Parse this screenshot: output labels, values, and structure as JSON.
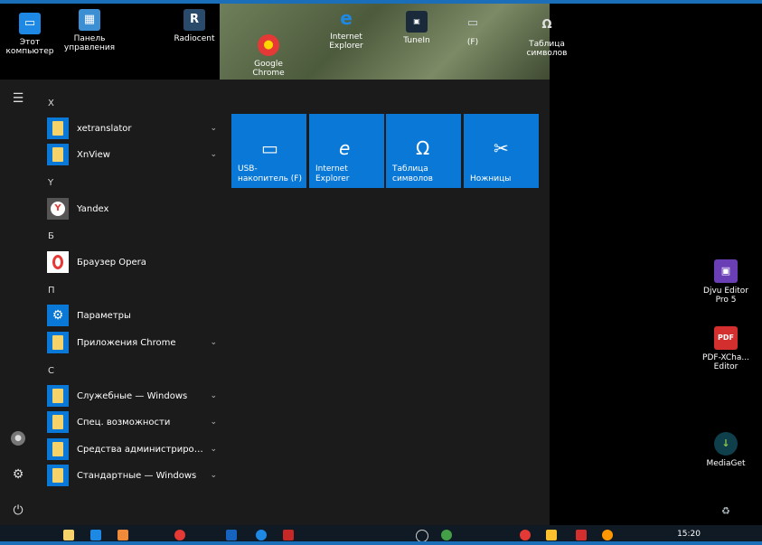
{
  "desktop_top": {
    "this_pc": "Этот компьютер",
    "control_panel": "Панель управления",
    "radiocent": "Radiocent",
    "chrome": "Google Chrome",
    "ie": "Internet Explorer",
    "tunein": "TuneIn",
    "f_drive": "(F)",
    "charmap": "Таблица символов"
  },
  "start": {
    "letters": [
      "X",
      "Y",
      "Б",
      "П",
      "С"
    ],
    "apps": {
      "xetranslator": "xetranslator",
      "xnview": "XnView",
      "yandex": "Yandex",
      "opera": "Браузер Opera",
      "params": "Параметры",
      "chrome_apps": "Приложения Chrome",
      "sys_tools": "Служебные — Windows",
      "access": "Спец. возможности",
      "admin": "Средства администрировани...",
      "standard": "Стандартные — Windows"
    },
    "chevron": "⌄"
  },
  "tiles": {
    "usb": "USB-накопитель (F)",
    "ie": "Internet Explorer",
    "charmap": "Таблица символов",
    "scissors": "Ножницы"
  },
  "desktop_right": {
    "djvu": "Djvu Editor Pro 5",
    "pdf": "PDF-XCha... Editor",
    "mediaget": "MediaGet"
  },
  "taskbar": {
    "clock": "15:20"
  },
  "icons": {
    "hamburger": "☰",
    "user": "●",
    "settings": "⚙",
    "power": "⏻",
    "chrome": "●",
    "ie": "e"
  },
  "colors": {
    "accent": "#0a78d7",
    "folder": "#f6d36a"
  }
}
